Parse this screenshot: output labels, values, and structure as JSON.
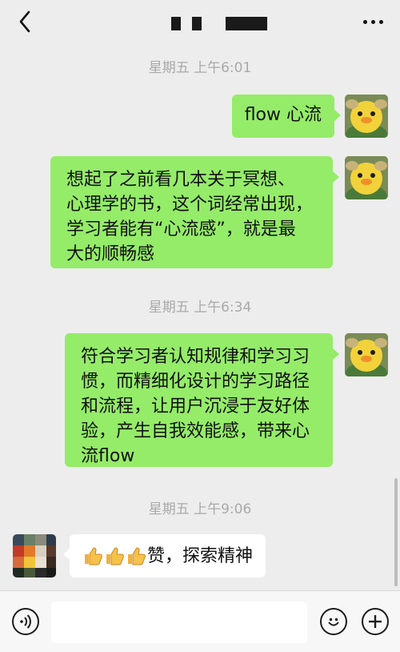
{
  "header": {
    "back_icon": "chevron-left-icon",
    "more_icon": "ellipsis-icon"
  },
  "messages": [
    {
      "type": "time",
      "text": "星期五 上午6:01"
    },
    {
      "type": "message",
      "side": "right",
      "lines": [
        "flow 心流"
      ]
    },
    {
      "type": "message",
      "side": "right",
      "lines": [
        "想起了之前看几本关于冥想、",
        "心理学的书，这个词经常出现，",
        "学习者能有“心流感”，就是最",
        "大的顺畅感"
      ]
    },
    {
      "type": "time",
      "text": "星期五 上午6:34"
    },
    {
      "type": "message",
      "side": "right",
      "lines": [
        "符合学习者认知规律和学习习",
        "惯，而精细化设计的学习路径",
        "和流程，让用户沉浸于友好体",
        "验，产生自我效能感，带来心",
        "流flow"
      ]
    },
    {
      "type": "time",
      "text": "星期五 上午9:06"
    },
    {
      "type": "message",
      "side": "left",
      "emoji": [
        "thumbs-up",
        "thumbs-up",
        "thumbs-up"
      ],
      "text": "赞，探索精神"
    }
  ],
  "input_bar": {
    "voice_icon": "voice-icon",
    "emoji_icon": "smiley-icon",
    "plus_icon": "plus-icon",
    "input_value": ""
  },
  "colors": {
    "background": "#ededed",
    "sent_bubble": "#95ec69",
    "received_bubble": "#ffffff",
    "timestamp": "#a9a9a9"
  }
}
